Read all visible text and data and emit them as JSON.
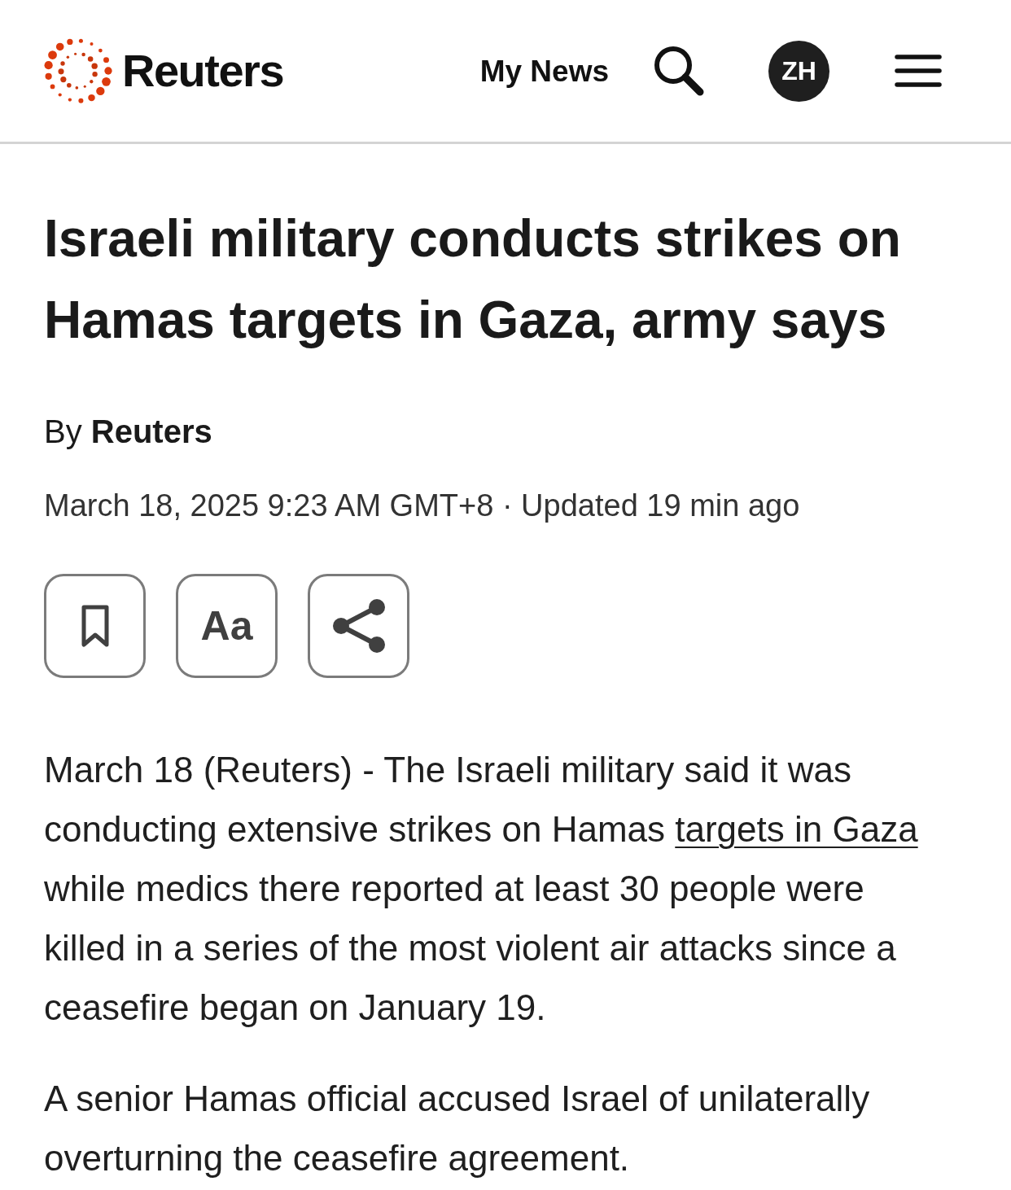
{
  "header": {
    "logo": {
      "wordmark": "Reuters"
    },
    "nav_link": "My News",
    "language_badge": "ZH"
  },
  "article": {
    "headline": "Israeli military conducts strikes on Hamas targets in Gaza, army says",
    "byline": "By **Reuters**",
    "dateline": "March 18, 2025 9:23 AM GMT+8 · Updated 19 min ago",
    "actions": [
      {
        "kind": "bookmark"
      },
      {
        "kind": "text_size",
        "label": "Aa"
      },
      {
        "kind": "share"
      }
    ],
    "paragraphs": [
      {
        "segments": [
          {
            "kind": "text",
            "text": "March 18 (Reuters) - The Israeli military said it was conducting extensive strikes on Hamas "
          },
          {
            "kind": "link",
            "text": "targets in Gaza"
          },
          {
            "kind": "text",
            "text": " while medics there reported at least 30 people were killed in a series of the most violent air attacks since a ceasefire began on January 19."
          }
        ]
      },
      {
        "segments": [
          {
            "kind": "text",
            "text": "A senior Hamas official accused Israel of unilaterally overturning the ceasefire agreement."
          }
        ]
      }
    ]
  }
}
